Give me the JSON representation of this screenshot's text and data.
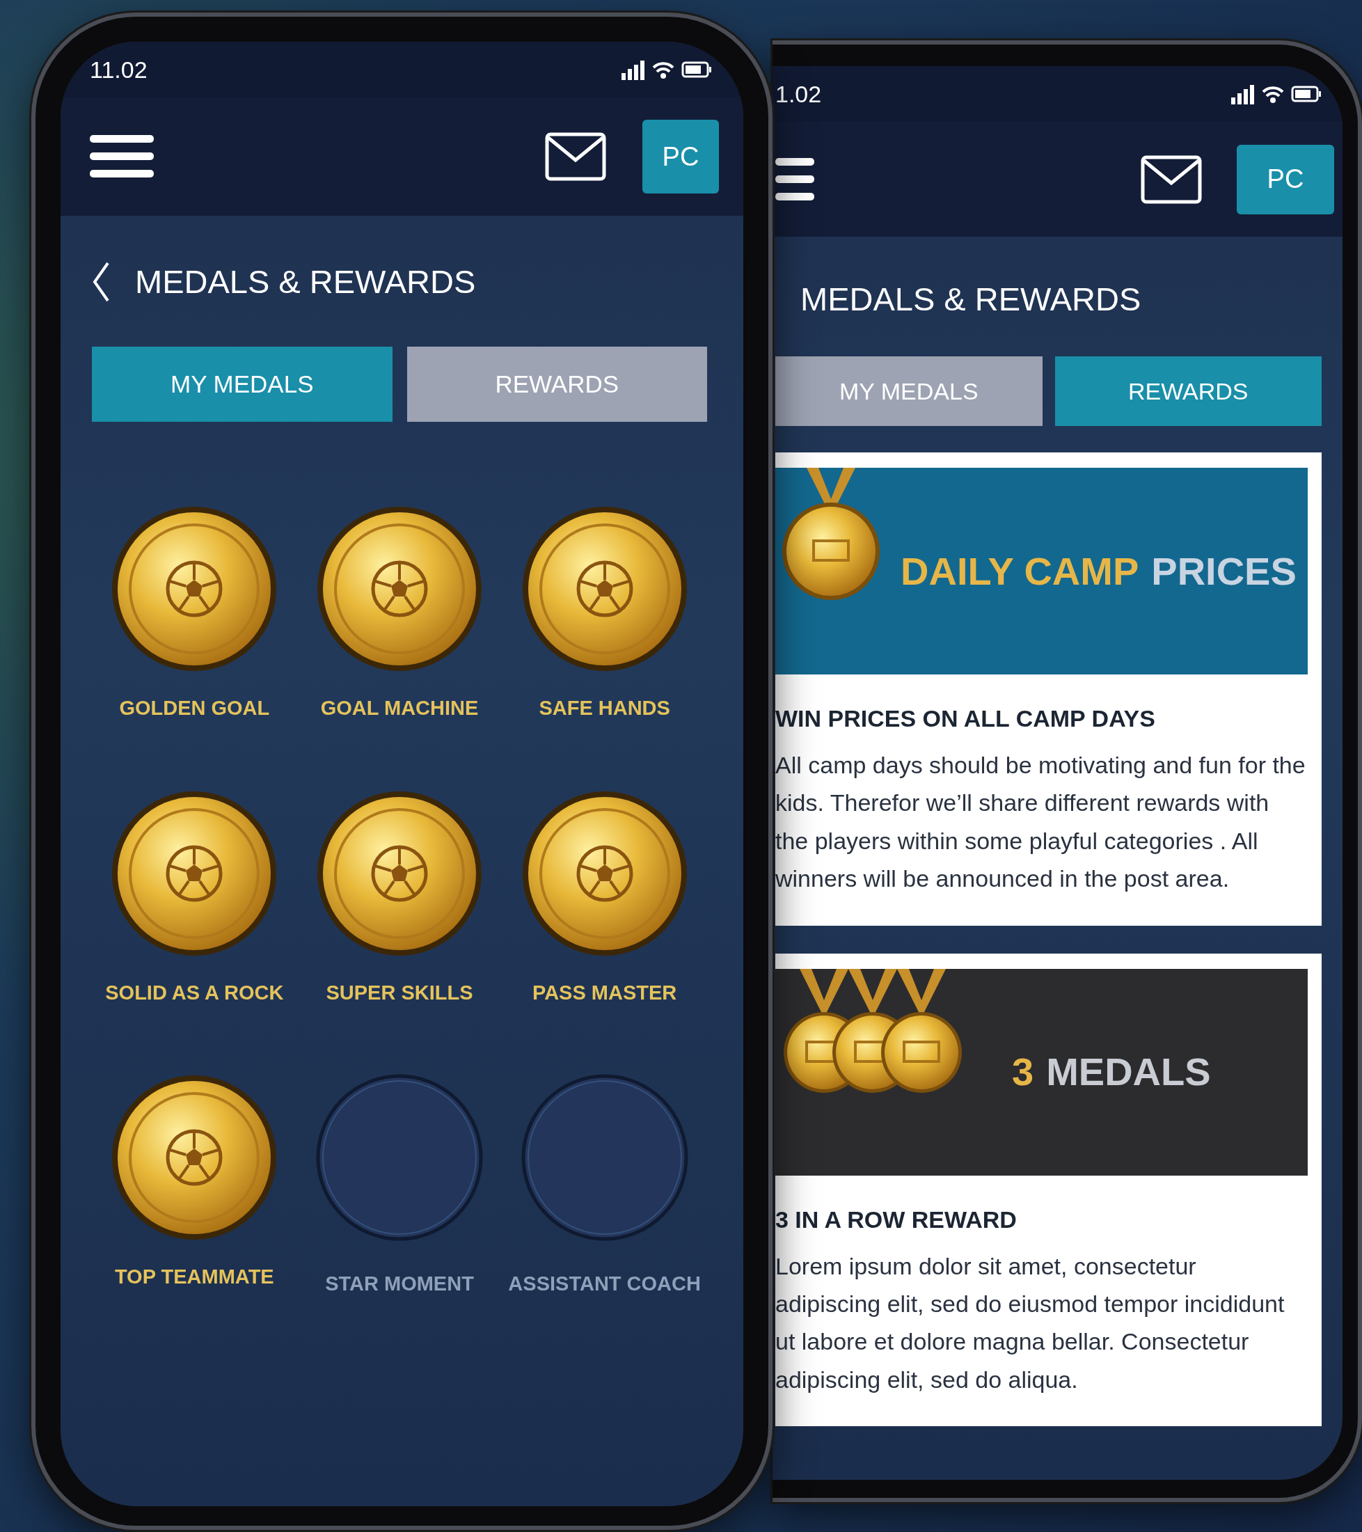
{
  "phones": [
    {
      "status_time": "11.02",
      "avatar": "PC",
      "back": true,
      "title": "MEDALS & REWARDS",
      "tabs": [
        {
          "label": "MY MEDALS",
          "selected": true
        },
        {
          "label": "REWARDS",
          "selected": false
        }
      ],
      "medals": [
        {
          "label": "GOLDEN GOAL",
          "earned": true
        },
        {
          "label": "GOAL MACHINE",
          "earned": true
        },
        {
          "label": "SAFE HANDS",
          "earned": true
        },
        {
          "label": "SOLID AS A ROCK",
          "earned": true
        },
        {
          "label": "SUPER SKILLS",
          "earned": true
        },
        {
          "label": "PASS MASTER",
          "earned": true
        },
        {
          "label": "TOP TEAMMATE",
          "earned": true
        },
        {
          "label": "STAR MOMENT",
          "earned": false
        },
        {
          "label": "ASSISTANT COACH",
          "earned": false
        }
      ]
    },
    {
      "status_time": "1.02",
      "avatar": "PC",
      "back": false,
      "title": "MEDALS & REWARDS",
      "tabs": [
        {
          "label": "MY MEDALS",
          "selected": false
        },
        {
          "label": "REWARDS",
          "selected": true
        }
      ],
      "rewards": [
        {
          "kind": "single",
          "title_parts": [
            {
              "text": "DAILY CAMP",
              "color": "#e6b648"
            },
            {
              "text": "PRICES",
              "color": "#c9d4e2"
            }
          ],
          "heading": "WIN PRICES ON ALL CAMP DAYS",
          "body": "All camp days should be motivating and fun for the kids. Therefor we’ll share different rewards with the players within some playful categories . All winners will be announced in the post area."
        },
        {
          "kind": "triple",
          "title_parts": [
            {
              "text": "3",
              "color": "#e6b648"
            },
            {
              "text": "MEDALS",
              "color": "#c9cdd3"
            }
          ],
          "heading": "3 IN A ROW REWARD",
          "body": "Lorem ipsum dolor sit amet, consectetur adipiscing elit, sed do eiusmod tempor incididunt ut labore et dolore magna bellar. Consectetur adipiscing elit, sed do aliqua."
        }
      ]
    }
  ]
}
